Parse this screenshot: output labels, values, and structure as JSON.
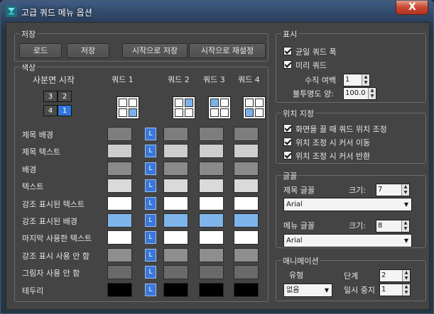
{
  "window": {
    "title": "고급 쿼드 메뉴 옵션",
    "close": "X"
  },
  "save_group": {
    "title": "저장",
    "buttons": [
      "로드",
      "저장",
      "시작으로 저장",
      "시작으로 재설정"
    ]
  },
  "color_group": {
    "title": "색상",
    "quad_start_label": "사분면 시작",
    "quad_cells": [
      "3",
      "2",
      "4",
      "1"
    ],
    "quad_headers": [
      "쿼드 1",
      "쿼드 2",
      "쿼드 3",
      "쿼드 4"
    ],
    "lock_label": "L",
    "rows": [
      {
        "label": "제목 배경",
        "colors": [
          "#7d7d7d",
          "#7d7d7d",
          "#7d7d7d",
          "#7d7d7d"
        ]
      },
      {
        "label": "제목 텍스트",
        "colors": [
          "#cdcdcd",
          "#cdcdcd",
          "#cdcdcd",
          "#cdcdcd"
        ]
      },
      {
        "label": "배경",
        "colors": [
          "#8a8a8a",
          "#8a8a8a",
          "#8a8a8a",
          "#8a8a8a"
        ]
      },
      {
        "label": "텍스트",
        "colors": [
          "#dadada",
          "#dadada",
          "#dadada",
          "#dadada"
        ]
      },
      {
        "label": "강조 표시된 텍스트",
        "colors": [
          "#ffffff",
          "#ffffff",
          "#ffffff",
          "#ffffff"
        ]
      },
      {
        "label": "강조 표시된 배경",
        "colors": [
          "#7fb4ea",
          "#7fb4ea",
          "#7fb4ea",
          "#7fb4ea"
        ]
      },
      {
        "label": "마지막 사용한 텍스트",
        "colors": [
          "#ffffff",
          "#ffffff",
          "#ffffff",
          "#ffffff"
        ]
      },
      {
        "label": "강조 표시 사용 안 함",
        "colors": [
          "#8e8e8e",
          "#8e8e8e",
          "#8e8e8e",
          "#8e8e8e"
        ]
      },
      {
        "label": "그림자 사용 안 함",
        "colors": [
          "#6a6a6a",
          "#6a6a6a",
          "#6a6a6a",
          "#6a6a6a"
        ]
      },
      {
        "label": "테두리",
        "colors": [
          "#000000",
          "#000000",
          "#000000",
          "#000000"
        ]
      }
    ]
  },
  "display_group": {
    "title": "표시",
    "uniform_width": "균일 쿼드 폭",
    "preview_quad": "미리 쿼드",
    "vertical_margin_label": "수직 여백",
    "vertical_margin_value": "1",
    "opacity_label": "불투명도 양:",
    "opacity_value": "100.0"
  },
  "position_group": {
    "title": "위치 지정",
    "items": [
      "화면을 끌 때 쿼드 위치 조정",
      "위치 조정 시 커서 이동",
      "위치 조정 시 커서 반환"
    ]
  },
  "font_group": {
    "title": "글꼴",
    "title_font_label": "제목 글꼴",
    "title_size_label": "크기:",
    "title_size_value": "7",
    "title_font_value": "Arial",
    "menu_font_label": "메뉴 글꼴",
    "menu_size_label": "크기:",
    "menu_size_value": "8",
    "menu_font_value": "Arial"
  },
  "anim_group": {
    "title": "애니메이션",
    "type_label": "유형",
    "type_value": "없음",
    "steps_label": "단계",
    "steps_value": "2",
    "pause_label": "일시 중지",
    "pause_value": "1"
  }
}
